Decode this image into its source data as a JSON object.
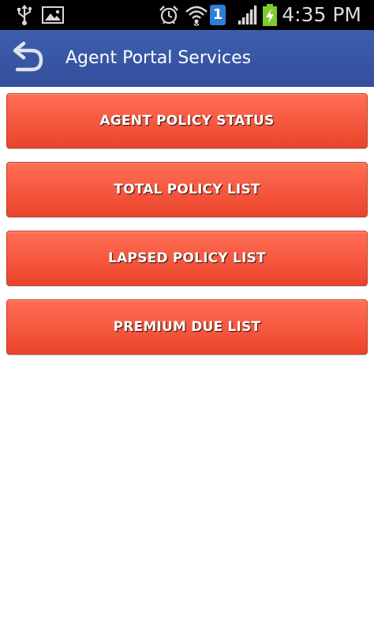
{
  "status_bar": {
    "time": "4:35 PM",
    "notification_badge": "1",
    "icons": [
      "usb-icon",
      "image-icon",
      "alarm-icon",
      "wifi-icon",
      "notification-badge-icon",
      "signal-icon",
      "battery-charging-icon"
    ]
  },
  "action_bar": {
    "title": "Agent Portal Services",
    "back_icon": "back-arrow-icon"
  },
  "menu": {
    "items": [
      {
        "label": "AGENT POLICY STATUS"
      },
      {
        "label": "TOTAL POLICY LIST"
      },
      {
        "label": "LAPSED POLICY LIST"
      },
      {
        "label": "PREMIUM DUE LIST"
      }
    ]
  },
  "colors": {
    "status_bar_bg": "#000000",
    "action_bar_bg": "#3a5aa8",
    "button_top": "#ff6f55",
    "button_bottom": "#e9442b",
    "button_text": "#ffffff",
    "badge_bg": "#2f7fd8",
    "battery_green": "#7ecb2f"
  }
}
